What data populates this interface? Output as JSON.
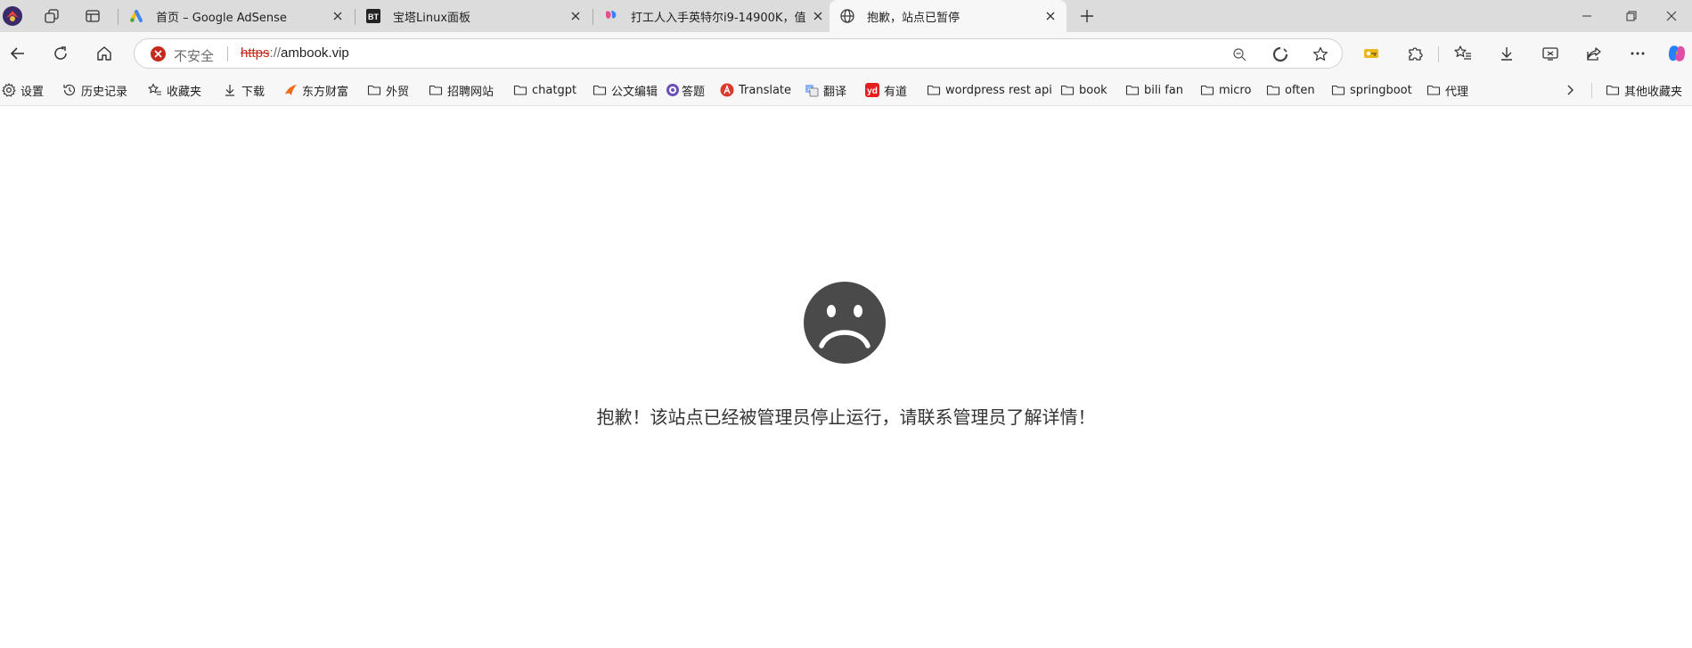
{
  "tabs": [
    {
      "title": "首页 – Google AdSense",
      "icon": "google-adsense-icon",
      "active": false
    },
    {
      "title": "宝塔Linux面板",
      "icon": "bt-panel-icon",
      "active": false
    },
    {
      "title": "打工人入手英特尔i9-14900K，值",
      "icon": "smzdm-icon",
      "active": false
    },
    {
      "title": "抱歉，站点已暂停",
      "icon": "globe-icon",
      "active": true
    }
  ],
  "address_bar": {
    "security_label": "不安全",
    "url_scheme": "https",
    "url_separator": "://",
    "url_host": "ambook.vip"
  },
  "bookmarks": [
    {
      "label": "设置",
      "icon": "gear-icon"
    },
    {
      "label": "历史记录",
      "icon": "history-icon"
    },
    {
      "label": "收藏夹",
      "icon": "star-list-icon"
    },
    {
      "label": "下载",
      "icon": "download-icon"
    },
    {
      "label": "东方财富",
      "icon": "eastmoney-icon"
    },
    {
      "label": "外贸",
      "icon": "folder-icon"
    },
    {
      "label": "招聘网站",
      "icon": "folder-icon"
    },
    {
      "label": "chatgpt",
      "icon": "folder-icon"
    },
    {
      "label": "公文编辑",
      "icon": "folder-icon"
    },
    {
      "label": "答题",
      "icon": "quiz-app-icon"
    },
    {
      "label": "Translate",
      "icon": "translate-app-icon"
    },
    {
      "label": "翻译",
      "icon": "translate-icon"
    },
    {
      "label": "有道",
      "icon": "youdao-icon"
    },
    {
      "label": "wordpress rest api",
      "icon": "folder-icon"
    },
    {
      "label": "book",
      "icon": "folder-icon"
    },
    {
      "label": "bili fan",
      "icon": "folder-icon"
    },
    {
      "label": "micro",
      "icon": "folder-icon"
    },
    {
      "label": "often",
      "icon": "folder-icon"
    },
    {
      "label": "springboot",
      "icon": "folder-icon"
    },
    {
      "label": "代理",
      "icon": "folder-icon"
    }
  ],
  "other_bookmarks": "其他收藏夹",
  "page": {
    "message": "抱歉！该站点已经被管理员停止运行，请联系管理员了解详情！",
    "face_color": "#4a4a4a"
  },
  "colors": {
    "tab_strip": "#dcdcdc",
    "toolbar": "#f7f7f7",
    "insecure_red": "#c42b1c"
  }
}
